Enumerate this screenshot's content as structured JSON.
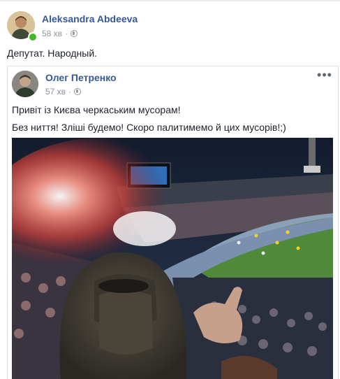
{
  "post": {
    "author": "Aleksandra Abdeeva",
    "time": "58 хв",
    "separator": "·",
    "audience_icon": "globe-icon",
    "text": "Депутат. Народный."
  },
  "shared": {
    "author": "Олег Петренко",
    "time": "57 хв",
    "separator": "·",
    "audience_icon": "globe-icon",
    "more_label": "•••",
    "line1": "Привіт із Києва черкаським мусорам!",
    "line2": "Без ниття! Зліші будемо! Скоро палитимемо й цих мусорів!;)"
  },
  "colors": {
    "link": "#365899",
    "meta": "#90949c",
    "text": "#1d2129",
    "online": "#42b72a",
    "border": "#dddfe2"
  }
}
